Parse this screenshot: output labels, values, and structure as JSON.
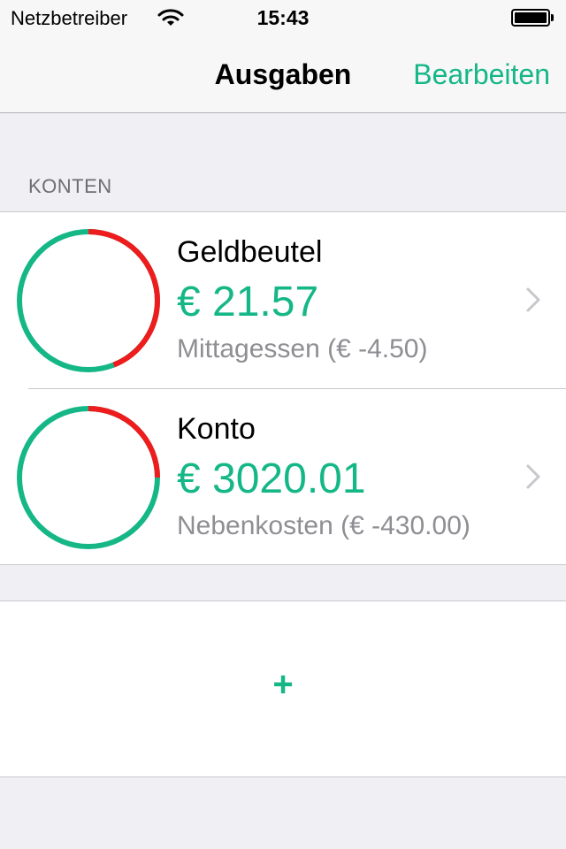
{
  "status_bar": {
    "carrier": "Netzbetreiber",
    "time": "15:43",
    "wifi_icon": "wifi-icon",
    "battery_icon": "battery-icon"
  },
  "nav": {
    "title": "Ausgaben",
    "edit_label": "Bearbeiten"
  },
  "section": {
    "header": "KONTEN"
  },
  "accounts": [
    {
      "name": "Geldbeutel",
      "balance": "€ 21.57",
      "last_expense": "Mittagessen (€ -4.50)",
      "ring_spent_fraction": 0.44
    },
    {
      "name": "Konto",
      "balance": "€ 3020.01",
      "last_expense": "Nebenkosten (€ -430.00)",
      "ring_spent_fraction": 0.25
    }
  ],
  "add_button": {
    "label": "+"
  },
  "colors": {
    "accent": "#15b787",
    "spent": "#ee1c1c",
    "background": "#efeff4",
    "secondary_text": "#8e8e93"
  }
}
